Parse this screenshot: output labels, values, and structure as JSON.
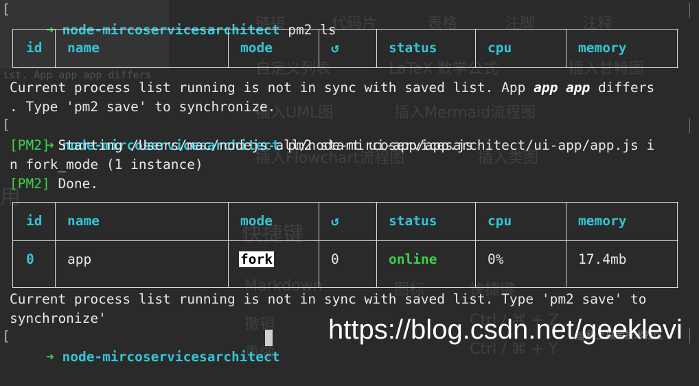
{
  "prompt": {
    "arrow": "➜",
    "dir": "node-mircoservicesarchitect"
  },
  "commands": {
    "cmd1": "pm2 ls",
    "cmd2": "pm2 start ui-app/app.js",
    "cmd3": ""
  },
  "table": {
    "headers": [
      "id",
      "name",
      "mode",
      "↺",
      "status",
      "cpu",
      "memory"
    ]
  },
  "table2": {
    "row": {
      "id": "0",
      "name": "app",
      "mode": "fork",
      "restarts": "0",
      "status": "online",
      "cpu": "0%",
      "memory": "17.4mb"
    }
  },
  "messages": {
    "sync1_a": "Current process list running is not in sync with saved list. App ",
    "sync1_bold": "app app",
    "sync1_b": " differs",
    "sync1_c": ". Type 'pm2 save' to synchronize.",
    "pm2_tag": "[PM2]",
    "starting_a": " Starting /Users/mac/nodejs-all/node-mircoservicesarchitect/ui-app/app.js i",
    "starting_b": "n fork_mode (1 instance)",
    "done": " Done.",
    "sync2_a": "Current process list running is not in sync with saved list. Type 'pm2 save' to",
    "sync2_b": "synchronize'"
  },
  "watermark": {
    "text": "https://blog.csdn.net/geeklevi",
    "small": "@稀土掘金技术社区"
  },
  "background_ghost": {
    "row1": [
      "链接",
      "代码片",
      "表格",
      "注脚",
      "注释"
    ],
    "row2": [
      "自定义列表",
      "LaTeX 数学公式",
      "插入甘特图"
    ],
    "row3": [
      "插入UML图",
      "插入Mermaid流程图"
    ],
    "row4": [
      "插入Flowchart流程图",
      "插入类图"
    ],
    "heading": "快捷键",
    "side": "用",
    "row5": [
      "Markdown",
      "图标",
      "快捷键"
    ],
    "row6": [
      "撤销",
      "Ctrl / ⌘ + Z"
    ],
    "row7": [
      "重做",
      "Ctrl / ⌘ + Y"
    ],
    "overlay": "ist. App app app differs"
  },
  "colors": {
    "background": "#2a2a2a",
    "cyan": "#33c5d6",
    "green": "#3cd14b"
  }
}
